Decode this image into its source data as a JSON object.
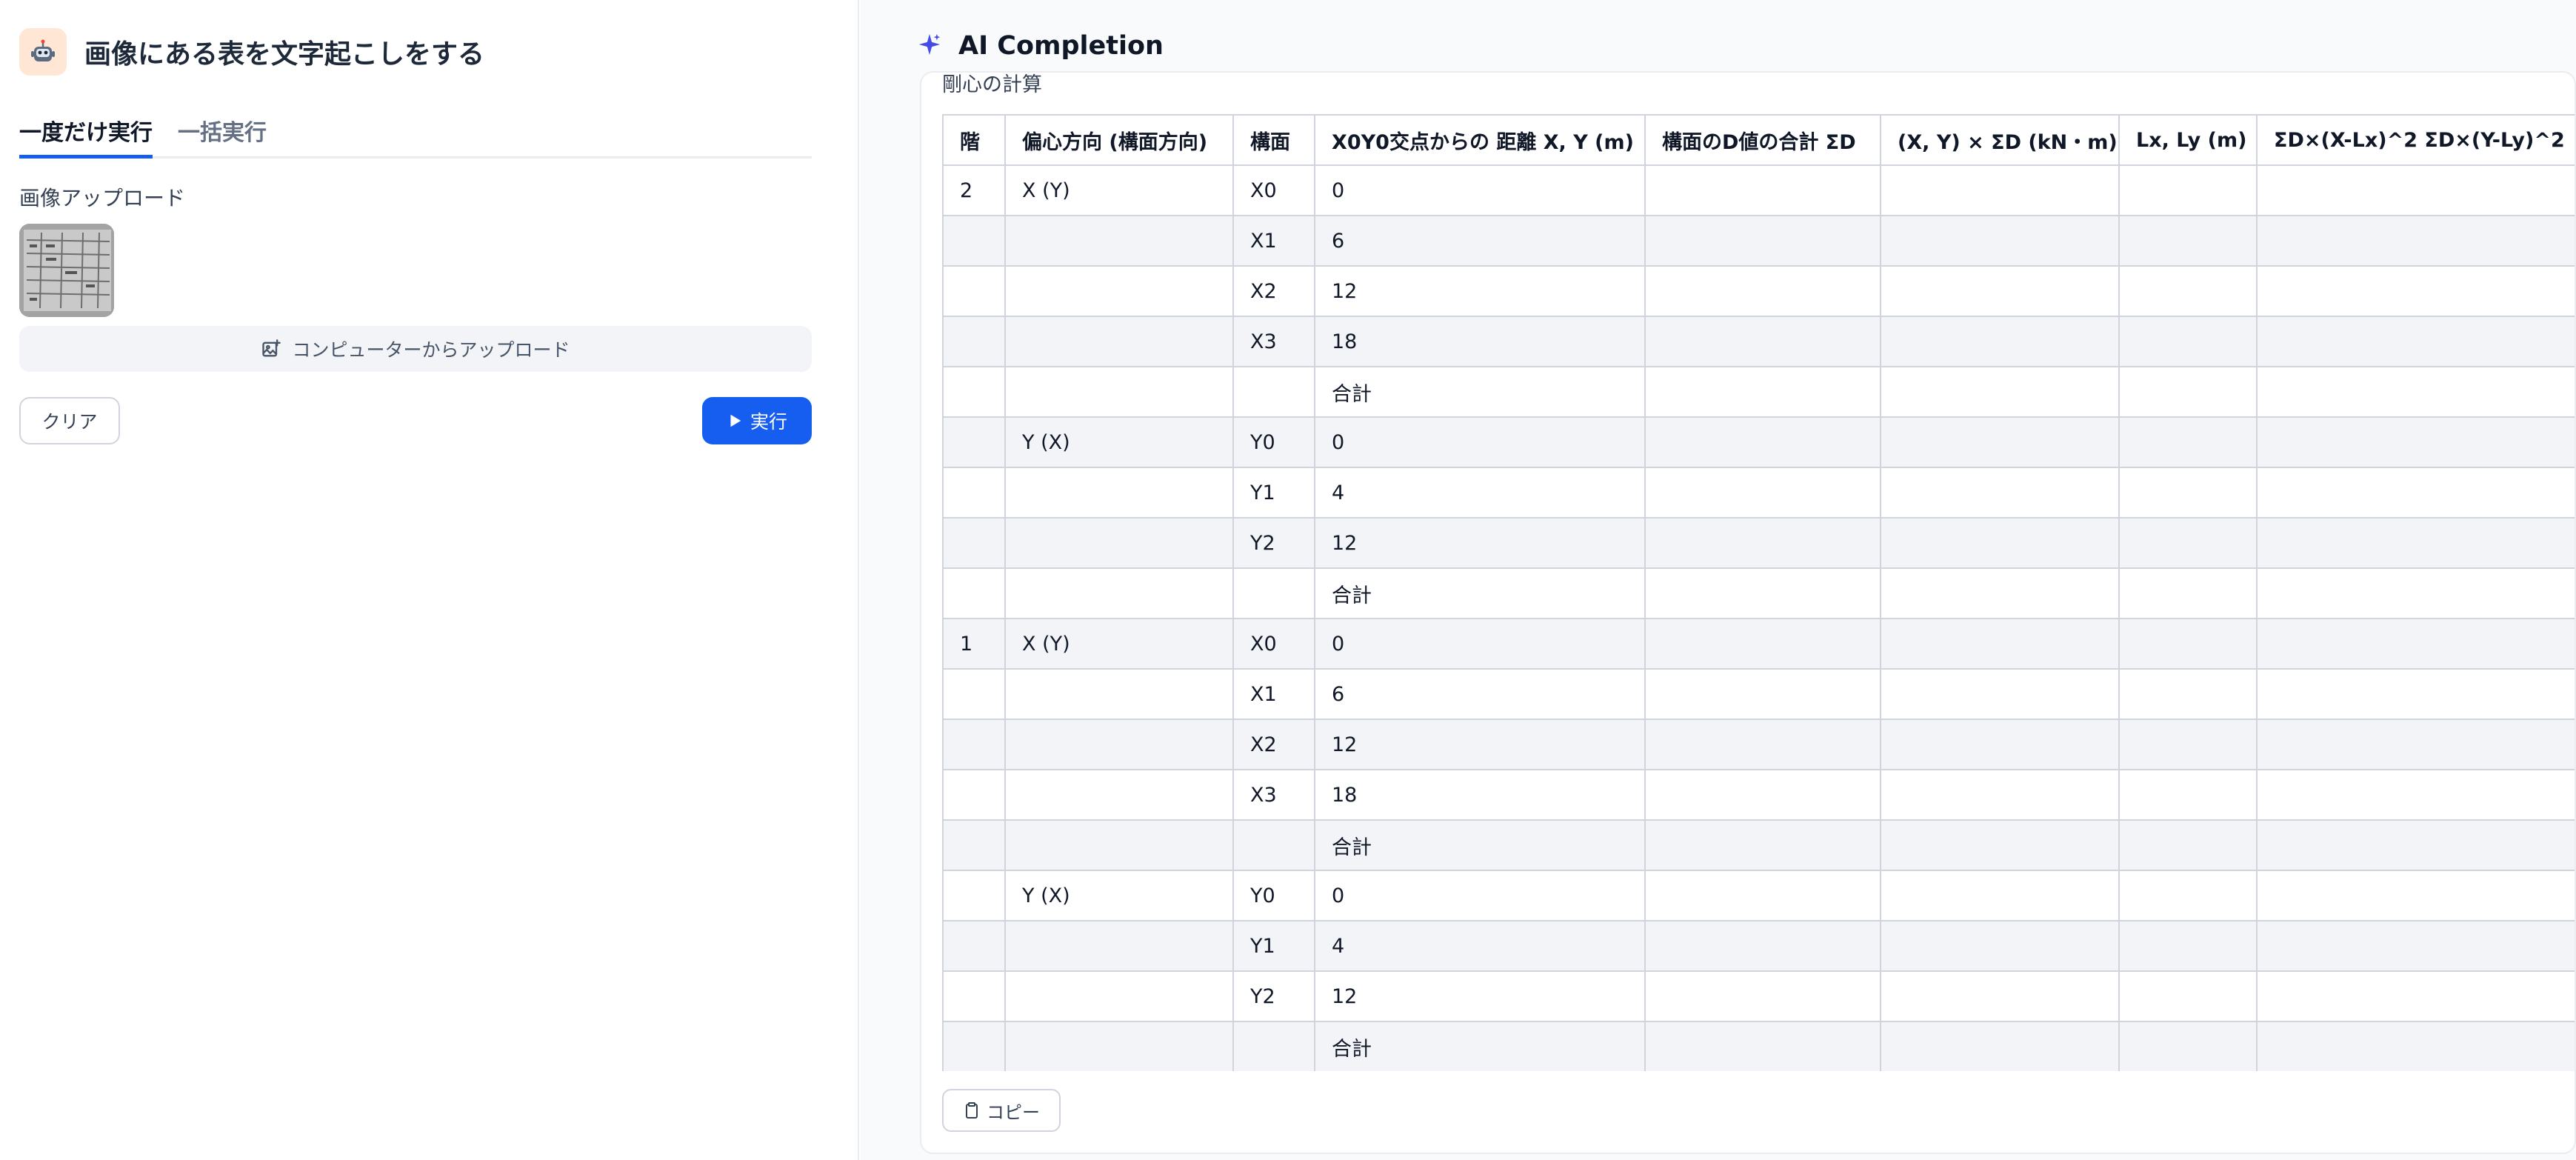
{
  "app": {
    "icon": "robot-icon",
    "title": "画像にある表を文字起こしをする"
  },
  "tabs": [
    {
      "label": "一度だけ実行",
      "active": true
    },
    {
      "label": "一括実行",
      "active": false
    }
  ],
  "upload": {
    "section_label": "画像アップロード",
    "button_label": "コンピューターからアップロード",
    "button_icon": "image-plus-icon"
  },
  "actions": {
    "clear_label": "クリア",
    "run_label": "実行",
    "run_icon": "play-icon"
  },
  "result": {
    "title": "AI Completion",
    "title_icon": "sparkle-icon",
    "heading": "剛心の計算",
    "copy_label": "コピー",
    "copy_icon": "clipboard-icon",
    "table": {
      "headers": [
        "階",
        "偏心方向 (構面方向)",
        "構面",
        "X0Y0交点からの 距離 X, Y (m)",
        "構面のD値の合計 ΣD",
        "(X, Y) × ΣD (kN・m)",
        "Lx, Ly (m)",
        "ΣD×(X-Lx)^2 ΣD×(Y-Ly)^2"
      ],
      "rows": [
        [
          "2",
          "X (Y)",
          "X0",
          "0",
          "",
          "",
          "",
          ""
        ],
        [
          "",
          "",
          "X1",
          "6",
          "",
          "",
          "",
          ""
        ],
        [
          "",
          "",
          "X2",
          "12",
          "",
          "",
          "",
          ""
        ],
        [
          "",
          "",
          "X3",
          "18",
          "",
          "",
          "",
          ""
        ],
        [
          "",
          "",
          "",
          "合計",
          "",
          "",
          "",
          ""
        ],
        [
          "",
          "Y (X)",
          "Y0",
          "0",
          "",
          "",
          "",
          ""
        ],
        [
          "",
          "",
          "Y1",
          "4",
          "",
          "",
          "",
          ""
        ],
        [
          "",
          "",
          "Y2",
          "12",
          "",
          "",
          "",
          ""
        ],
        [
          "",
          "",
          "",
          "合計",
          "",
          "",
          "",
          ""
        ],
        [
          "1",
          "X (Y)",
          "X0",
          "0",
          "",
          "",
          "",
          ""
        ],
        [
          "",
          "",
          "X1",
          "6",
          "",
          "",
          "",
          ""
        ],
        [
          "",
          "",
          "X2",
          "12",
          "",
          "",
          "",
          ""
        ],
        [
          "",
          "",
          "X3",
          "18",
          "",
          "",
          "",
          ""
        ],
        [
          "",
          "",
          "",
          "合計",
          "",
          "",
          "",
          ""
        ],
        [
          "",
          "Y (X)",
          "Y0",
          "0",
          "",
          "",
          "",
          ""
        ],
        [
          "",
          "",
          "Y1",
          "4",
          "",
          "",
          "",
          ""
        ],
        [
          "",
          "",
          "Y2",
          "12",
          "",
          "",
          "",
          ""
        ],
        [
          "",
          "",
          "",
          "合計",
          "",
          "",
          "",
          ""
        ]
      ]
    }
  },
  "colors": {
    "accent": "#155eef",
    "app_icon_bg": "#ffe6d5",
    "sparkle": "#444ce7"
  }
}
